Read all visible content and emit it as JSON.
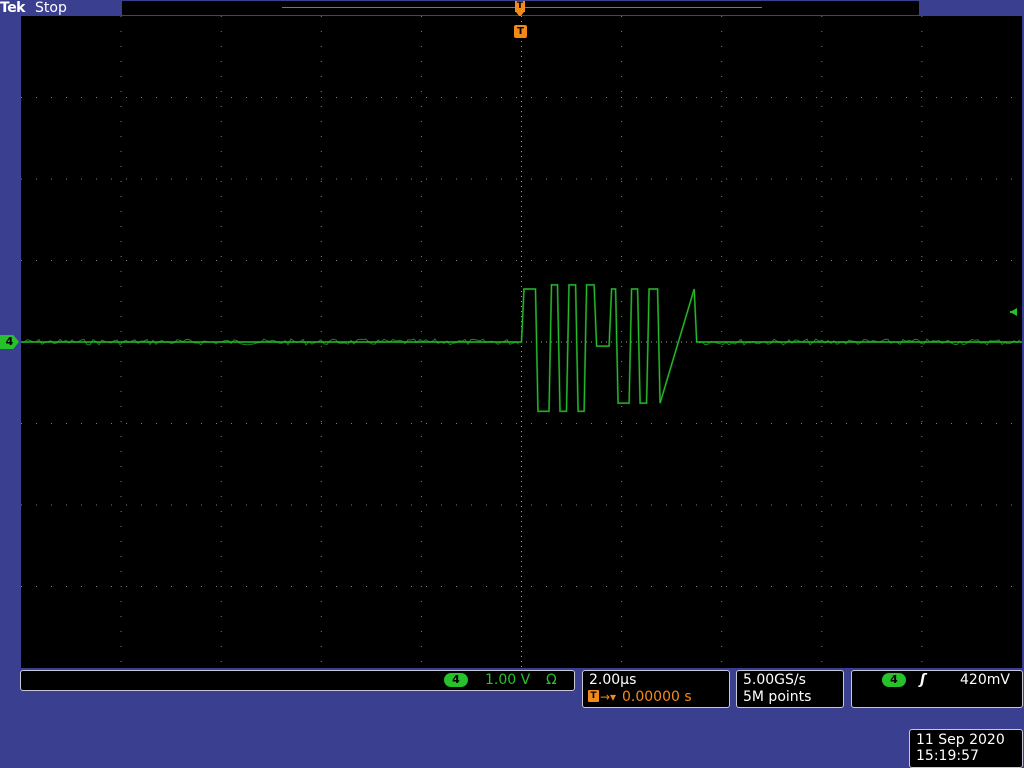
{
  "header": {
    "brand": "Tek",
    "state": "Stop"
  },
  "markers": {
    "trigger_glyph": "T",
    "channel_number": "4"
  },
  "channel_readout": {
    "channel": "4",
    "scale": "1.00 V",
    "impedance_symbol": "Ω"
  },
  "horizontal_readout": {
    "scale": "2.00µs",
    "position": "0.00000 s"
  },
  "acquisition_readout": {
    "sample_rate": "5.00GS/s",
    "record_length": "5M points"
  },
  "trigger_readout": {
    "source": "4",
    "slope_symbol": "ʃ",
    "level": "420mV"
  },
  "datetime": {
    "date": "11 Sep  2020",
    "time": "15:19:57"
  },
  "colors": {
    "frame": "#3b3f8f",
    "trace": "#26c12b",
    "trigger": "#f28a1a",
    "graticule": "#808080"
  },
  "graticule": {
    "divisions_x": 10,
    "divisions_y": 8
  },
  "chart_data": {
    "type": "line",
    "xlabel": "",
    "ylabel": "",
    "x_unit": "µs",
    "y_unit": "V",
    "xlim": [
      -10,
      10
    ],
    "ylim": [
      -4,
      4
    ],
    "grid": true,
    "series": [
      {
        "x": [
          -10,
          0,
          0.05,
          0.28,
          0.33,
          0.55,
          0.6,
          0.72,
          0.77,
          0.9,
          0.95,
          1.08,
          1.13,
          1.25,
          1.3,
          1.45,
          1.5,
          1.75,
          1.8,
          1.88,
          1.93,
          2.15,
          2.2,
          2.32,
          2.37,
          2.5,
          2.55,
          2.72,
          2.77,
          3.45,
          3.5,
          10
        ],
        "y": [
          0,
          0,
          0.65,
          0.65,
          -0.85,
          -0.85,
          0.7,
          0.7,
          -0.85,
          -0.85,
          0.7,
          0.7,
          -0.85,
          -0.85,
          0.7,
          0.7,
          -0.05,
          -0.05,
          0.65,
          0.65,
          -0.75,
          -0.75,
          0.65,
          0.65,
          -0.75,
          -0.75,
          0.65,
          0.65,
          -0.75,
          0.65,
          0,
          0
        ]
      }
    ],
    "trigger_level": 0.42
  }
}
